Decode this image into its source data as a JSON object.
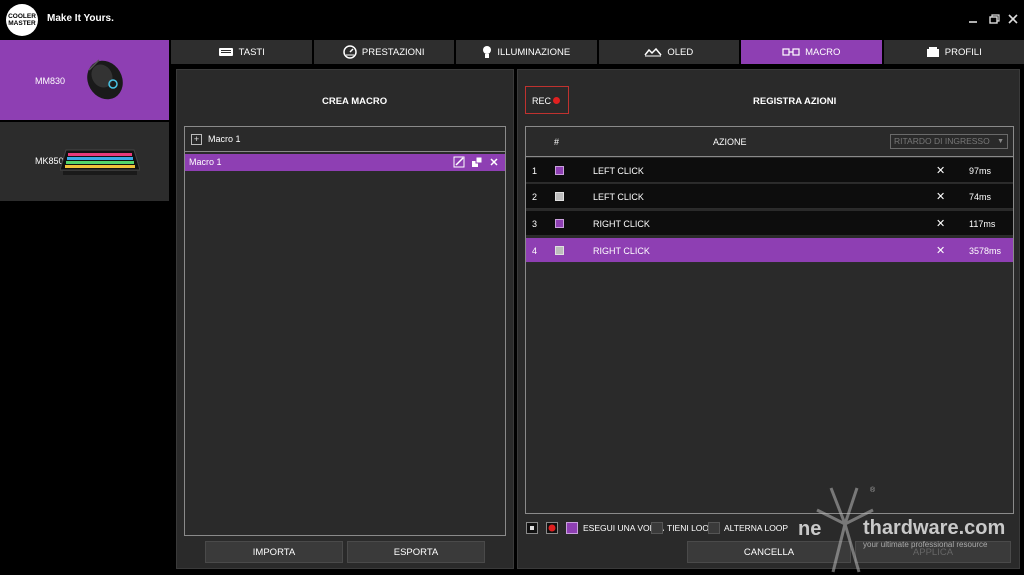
{
  "header": {
    "logo_text": "COOLER MASTER",
    "tagline": "Make It Yours."
  },
  "window_controls": {
    "minimize": "minimize-icon",
    "maximize": "maximize-icon",
    "close": "close-icon"
  },
  "devices": [
    {
      "name": "MM830",
      "selected": true
    },
    {
      "name": "MK850",
      "selected": false
    }
  ],
  "tabs": [
    {
      "label": "TASTI",
      "icon": "keyboard-icon",
      "active": false
    },
    {
      "label": "PRESTAZIONI",
      "icon": "gauge-icon",
      "active": false
    },
    {
      "label": "ILLUMINAZIONE",
      "icon": "bulb-icon",
      "active": false
    },
    {
      "label": "OLED",
      "icon": "oled-icon",
      "active": false
    },
    {
      "label": "MACRO",
      "icon": "macro-icon",
      "active": true
    },
    {
      "label": "PROFILI",
      "icon": "profile-icon",
      "active": false
    }
  ],
  "left_panel": {
    "title": "CREA MACRO",
    "add_label": "Macro 1",
    "selected_macro": "Macro 1",
    "import_label": "IMPORTA",
    "export_label": "ESPORTA"
  },
  "right_panel": {
    "rec_label": "REC",
    "title": "REGISTRA AZIONI",
    "col_num": "#",
    "col_action": "AZIONE",
    "delay_select": "RITARDO DI INGRESSO",
    "actions": [
      {
        "num": "1",
        "action": "LEFT CLICK",
        "delay": "97ms",
        "icon": "purple",
        "selected": false
      },
      {
        "num": "2",
        "action": "LEFT CLICK",
        "delay": "74ms",
        "icon": "gray",
        "selected": false
      },
      {
        "num": "3",
        "action": "RIGHT CLICK",
        "delay": "117ms",
        "icon": "purple",
        "selected": false
      },
      {
        "num": "4",
        "action": "RIGHT CLICK",
        "delay": "3578ms",
        "icon": "gray",
        "selected": true
      }
    ],
    "run_once": "ESEGUI UNA VOLTA",
    "hold_loop": "TIENI LOOP",
    "toggle_loop": "ALTERNA LOOP",
    "cancel_label": "CANCELLA",
    "apply_label": "APPLICA"
  },
  "watermark": {
    "brand_left": "ne",
    "brand_right": "thardware.com",
    "slogan": "your ultimate professional resource",
    "registered": "®"
  },
  "colors": {
    "accent": "#8e3fb3",
    "rec_red": "#e02020"
  }
}
